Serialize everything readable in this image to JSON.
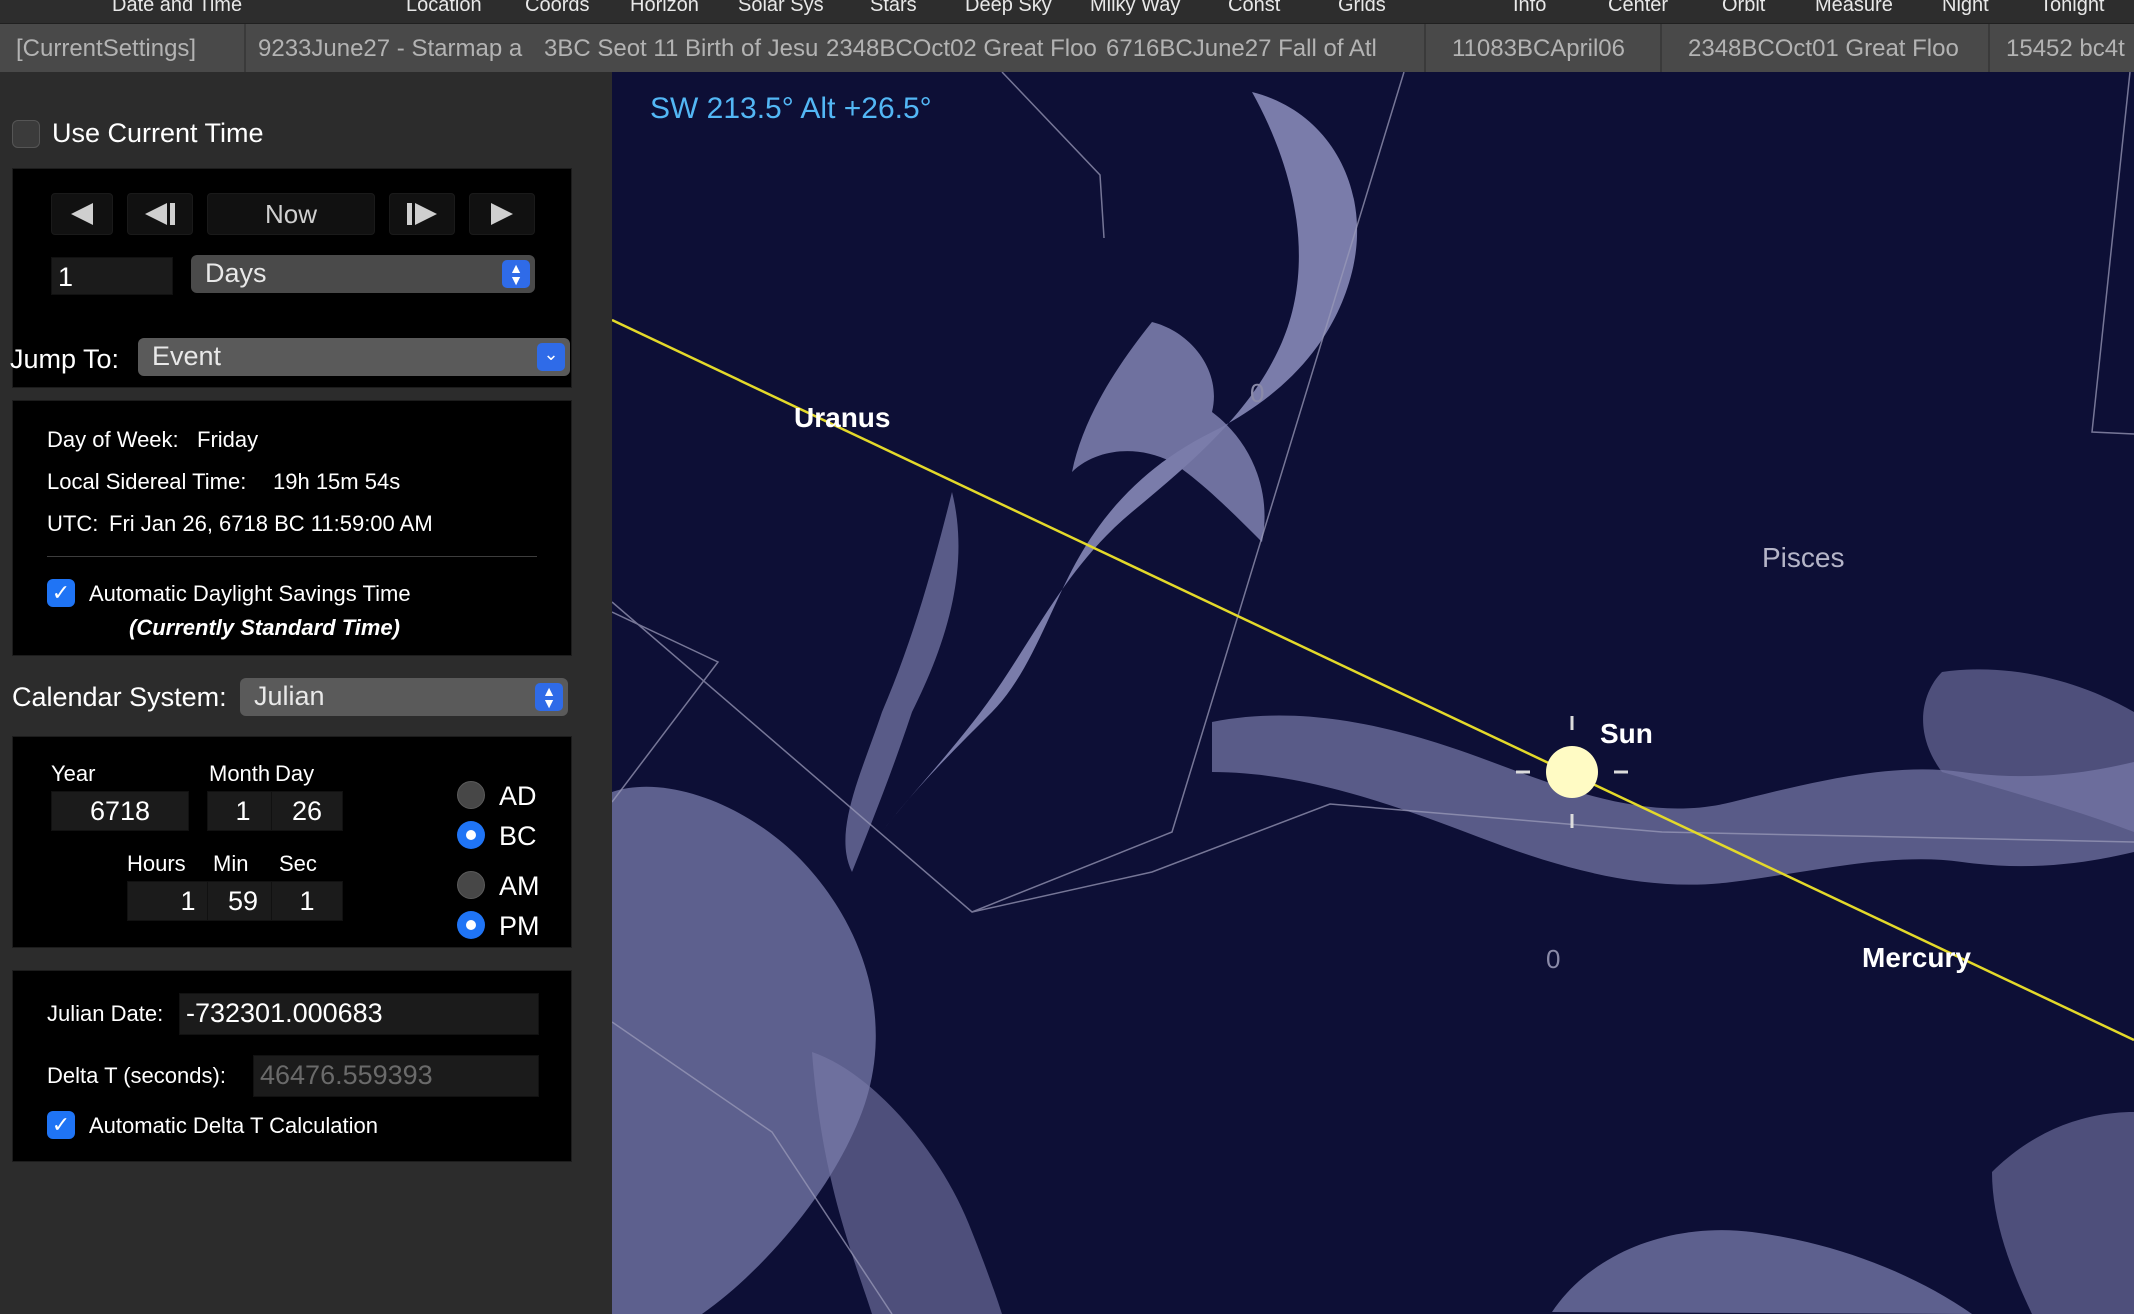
{
  "toolbar": {
    "items": [
      "Date and Time",
      "Location",
      "Coords",
      "Horizon",
      "Solar Sys",
      "Stars",
      "Deep Sky",
      "Milky Way",
      "Const",
      "Grids",
      "Info",
      "Center",
      "Orbit",
      "Measure",
      "Night",
      "Tonight"
    ]
  },
  "bookmarks": [
    "[CurrentSettings]",
    "9233June27 - Starmap a",
    "3BC Seot 11 Birth of Jesu",
    "2348BCOct02 Great Floo",
    "6716BCJune27 Fall of Atl",
    "11083BCApril06",
    "2348BCOct01 Great Floo",
    "15452 bc4t"
  ],
  "panel": {
    "use_current_time": {
      "label": "Use Current Time",
      "checked": false
    },
    "nav": {
      "now_label": "Now",
      "step_value": "1",
      "step_unit": "Days"
    },
    "jump_to": {
      "label": "Jump To:",
      "value": "Event"
    },
    "info": {
      "day_of_week_label": "Day of Week:",
      "day_of_week": "Friday",
      "sidereal_label": "Local Sidereal Time:",
      "sidereal": "19h 15m 54s",
      "utc_label": "UTC:",
      "utc": "Fri Jan 26, 6718 BC 11:59:00 AM",
      "dst_label": "Automatic Daylight Savings Time",
      "dst_checked": true,
      "dst_status": "(Currently Standard Time)"
    },
    "calendar": {
      "label": "Calendar System:",
      "value": "Julian"
    },
    "date": {
      "year_label": "Year",
      "year": "6718",
      "month_label": "Month",
      "month": "1",
      "day_label": "Day",
      "day": "26",
      "hours_label": "Hours",
      "hours": "1",
      "min_label": "Min",
      "min": "59",
      "sec_label": "Sec",
      "sec": "1",
      "ad_label": "AD",
      "bc_label": "BC",
      "era": "BC",
      "am_label": "AM",
      "pm_label": "PM",
      "meridiem": "PM"
    },
    "julian": {
      "jd_label": "Julian Date:",
      "jd": "-732301.000683",
      "delta_label": "Delta T (seconds):",
      "delta": "46476.559393",
      "auto_delta_label": "Automatic Delta T Calculation",
      "auto_delta_checked": true
    }
  },
  "sky": {
    "readout": "SW 213.5° Alt +26.5°",
    "labels": {
      "uranus": "Uranus",
      "sun": "Sun",
      "mercury": "Mercury",
      "pisces": "Pisces"
    },
    "grid_labels": [
      "0",
      "0"
    ],
    "colors": {
      "ecliptic": "#e3d92a",
      "sun": "#fffbc4",
      "background": "#0d0f36",
      "readout": "#53b7f5"
    }
  }
}
